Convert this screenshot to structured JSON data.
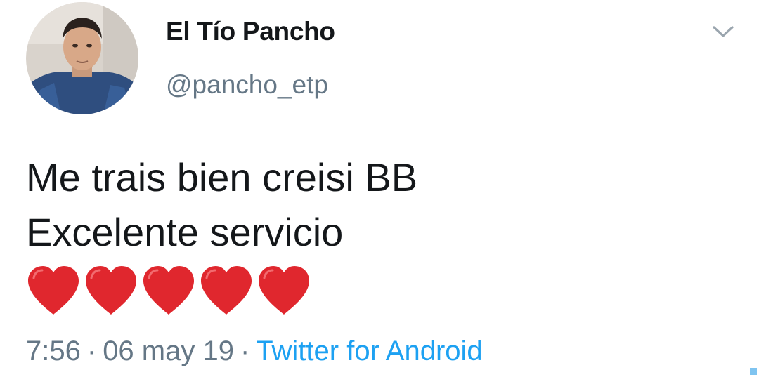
{
  "tweet": {
    "author": {
      "display_name": "El Tío Pancho",
      "handle": "@pancho_etp"
    },
    "text_lines": [
      "Me trais bien creisi BB",
      "Excelente servicio"
    ],
    "emoji": [
      "❤️",
      "❤️",
      "❤️",
      "❤️",
      "❤️"
    ],
    "time": "7:56",
    "date": "06 may 19",
    "separator": "·",
    "source": "Twitter for Android"
  },
  "icons": {
    "menu": "chevron-down-icon",
    "avatar": "profile-photo"
  },
  "colors": {
    "name": "#14171a",
    "secondary_text": "#657786",
    "link": "#1da1f2",
    "heart": "#e0272e"
  }
}
